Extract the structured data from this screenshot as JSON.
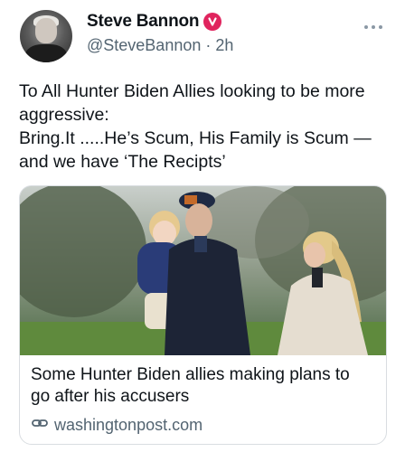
{
  "post": {
    "author": {
      "display_name": "Steve Bannon",
      "handle": "@SteveBannon",
      "time_sep": "·",
      "time_ago": "2h",
      "verified_color": "#e0245e"
    },
    "text": "To All Hunter Biden Allies looking to be more aggressive:\nBring.It .....He’s Scum, His Family is Scum — and we have ‘The Recipts’",
    "more_icon": "more-dots-icon",
    "card": {
      "title": "Some Hunter Biden allies making plans to go after his accusers",
      "domain": "washingtonpost.com",
      "link_icon": "link-icon"
    }
  }
}
